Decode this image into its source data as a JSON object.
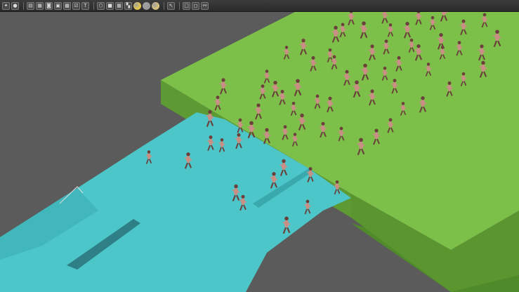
{
  "window": {
    "type": "3d-scene-editor-viewport"
  },
  "toolbar": {
    "groups": [
      [
        "gizmo-icon",
        "record-icon"
      ],
      [
        "layer-icon",
        "grid-icon",
        "camera-icon",
        "image-icon",
        "texture-icon",
        "checkbox-icon",
        "text-icon"
      ],
      [
        "cube-icon",
        "cube-solid-icon",
        "cube-grid-icon",
        "checker-icon",
        "sphere-yellow-icon",
        "sphere-gray-icon",
        "sphere-light-icon"
      ],
      [
        "pointer-icon"
      ],
      [
        "box-icon",
        "box-outline-icon",
        "node-graph-icon"
      ]
    ],
    "glyphs": {
      "gizmo-icon": "✦",
      "record-icon": "●",
      "layer-icon": "▤",
      "grid-icon": "▦",
      "camera-icon": "◙",
      "image-icon": "▣",
      "texture-icon": "▩",
      "checkbox-icon": "☑",
      "text-icon": "T",
      "cube-icon": "⬡",
      "cube-solid-icon": "■",
      "cube-grid-icon": "▦",
      "checker-icon": "▚",
      "sphere-yellow-icon": "",
      "sphere-gray-icon": "",
      "sphere-light-icon": "",
      "pointer-icon": "↖",
      "box-icon": "□",
      "box-outline-icon": "◻",
      "node-graph-icon": "⚯"
    }
  },
  "scene": {
    "colors": {
      "background": "#5b5b5b",
      "platform_top": "#7cc04a",
      "platform_side": "#5e9a33",
      "platform_side_dark": "#4f8a2b",
      "water": "#4cc6c8",
      "water_dark": "#3aa9ad",
      "character_skin": "#c98f84",
      "character_shadow": "#6b3f3a"
    }
  }
}
